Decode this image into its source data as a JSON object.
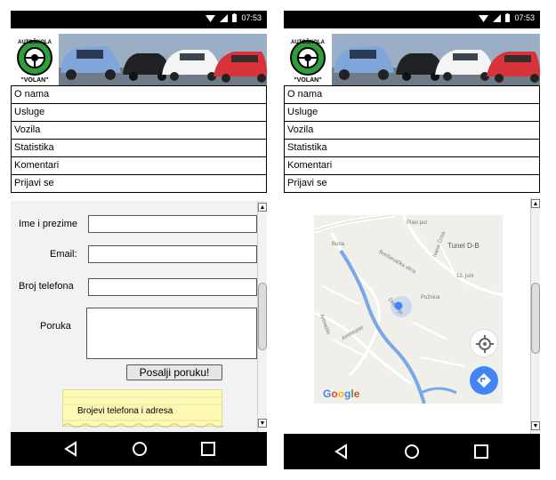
{
  "status": {
    "time": "07:53"
  },
  "logo": {
    "line1": "AUTOŠKOLA",
    "line2": "\"VOLAN\""
  },
  "menu": [
    "O nama",
    "Usluge",
    "Vozila",
    "Statistika",
    "Komentari",
    "Prijavi se"
  ],
  "form": {
    "name_label": "Ime i prezime",
    "email_label": "Email:",
    "phone_label": "Broj telefona",
    "message_label": "Poruka",
    "send_label": "Posalji poruku!",
    "note": "Brojevi telefona i adresa"
  },
  "map": {
    "labels": [
      "Tunel D-B",
      "Plavi put",
      "Buna",
      "Boriševačka ulica",
      "Amfiteatar",
      "Dobrinje",
      "Ivana Ćosa",
      "Armadile",
      "Pužnica",
      "12. juni"
    ],
    "google": "Google"
  },
  "colors": {
    "accent_blue": "#4285f4",
    "river": "#79a8e8",
    "note": "#fff9b6"
  }
}
